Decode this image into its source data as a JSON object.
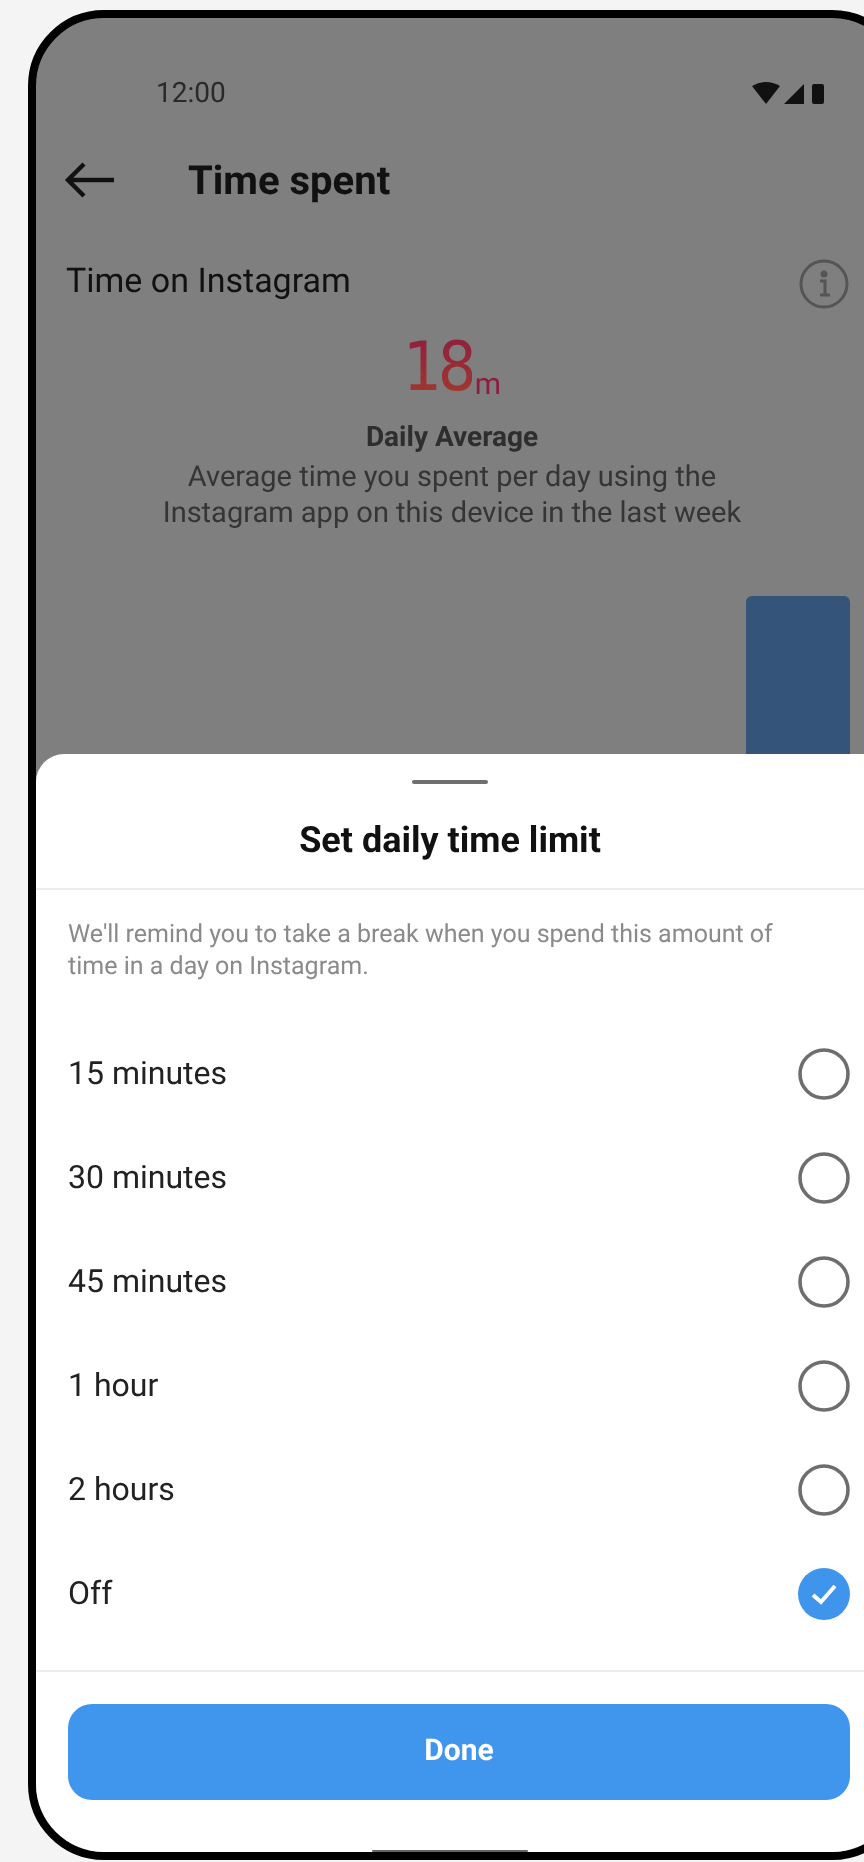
{
  "status_bar": {
    "time": "12:00"
  },
  "header": {
    "title": "Time spent"
  },
  "section": {
    "title": "Time on Instagram"
  },
  "daily_average": {
    "value": "18",
    "unit": "m",
    "label": "Daily Average",
    "description": "Average time you spent per day using the Instagram app on this device in the last week"
  },
  "sheet": {
    "title": "Set daily time limit",
    "description": "We'll remind you to take a break when you spend this amount of time in a day on Instagram.",
    "options": [
      {
        "label": "15 minutes",
        "selected": false
      },
      {
        "label": "30 minutes",
        "selected": false
      },
      {
        "label": "45 minutes",
        "selected": false
      },
      {
        "label": "1 hour",
        "selected": false
      },
      {
        "label": "2 hours",
        "selected": false
      },
      {
        "label": "Off",
        "selected": true
      }
    ],
    "button": "Done"
  }
}
